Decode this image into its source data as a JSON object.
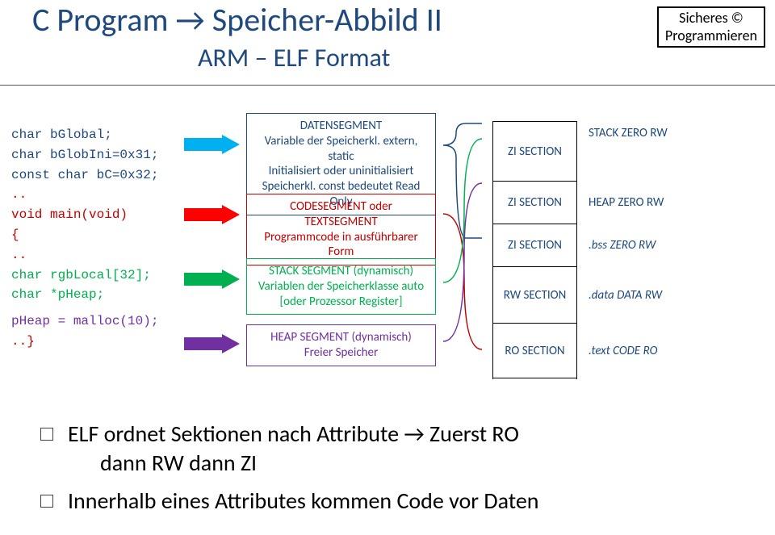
{
  "header": {
    "title": "C Program → Speicher-Abbild II",
    "subtitle": "ARM – ELF Format",
    "badge_top": "Sicheres ©",
    "badge_bottom": "Programmieren"
  },
  "code": {
    "l1": "char bGlobal;",
    "l2": "char bGlobIni=0x31;",
    "l3": "const char bC=0x32;",
    "l4": "..",
    "l5": "void main(void)",
    "l6": "{",
    "l7": "..",
    "l8": "char rgbLocal[32];",
    "l9": "char *pHeap;",
    "l10": "pHeap = malloc(10);",
    "l11": "..}"
  },
  "segments": {
    "data": {
      "title": "DATENSEGMENT",
      "line1": "Variable der Speicherkl. extern, static",
      "line2": "Initialisiert oder uninitialisiert",
      "line3": "Speicherkl. const bedeutet Read Only"
    },
    "code": {
      "title": "CODESEGMENT oder TEXTSEGMENT",
      "line1": "Programmcode in ausführbarer Form"
    },
    "stack": {
      "title": "STACK SEGMENT (dynamisch)",
      "line1": "Variablen der Speicherklasse auto",
      "line2": "[oder Prozessor Register]"
    },
    "heap": {
      "title": "HEAP SEGMENT (dynamisch)",
      "line1": "Freier Speicher"
    }
  },
  "sections": {
    "rows": [
      {
        "name": "ZI SECTION",
        "label": "STACK ZERO RW"
      },
      {
        "name": "ZI SECTION",
        "label": "HEAP ZERO RW"
      },
      {
        "name": "ZI SECTION",
        "label": ".bss ZERO RW",
        "italic": true
      },
      {
        "name": "RW SECTION",
        "label": ".data DATA RW",
        "italic": true
      },
      {
        "name": "RO SECTION",
        "label": ".text CODE RO",
        "italic": true
      }
    ]
  },
  "bullets": {
    "b1a": "ELF ordnet Sektionen nach Attribute → Zuerst RO",
    "b1b": "dann RW dann ZI",
    "b2": "Innerhalb eines Attributes kommen Code vor Daten"
  }
}
